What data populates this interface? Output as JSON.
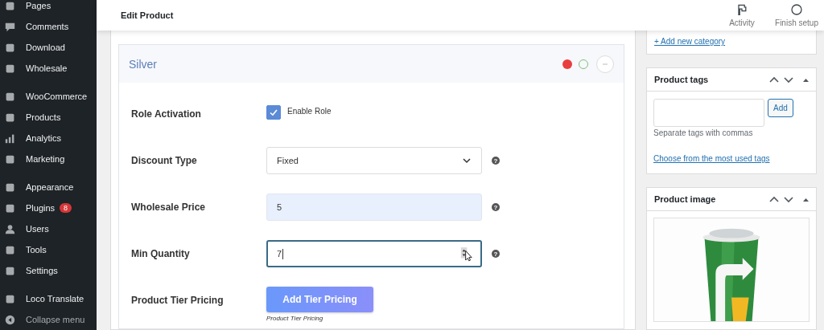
{
  "sidebar": {
    "groups": [
      [
        {
          "label": "Pages"
        },
        {
          "label": "Comments"
        },
        {
          "label": "Download"
        },
        {
          "label": "Wholesale"
        }
      ],
      [
        {
          "label": "WooCommerce"
        },
        {
          "label": "Products"
        },
        {
          "label": "Analytics"
        },
        {
          "label": "Marketing"
        }
      ],
      [
        {
          "label": "Appearance"
        },
        {
          "label": "Plugins",
          "badge": "8"
        },
        {
          "label": "Users"
        },
        {
          "label": "Tools"
        },
        {
          "label": "Settings"
        }
      ],
      [
        {
          "label": "Loco Translate"
        },
        {
          "label": "Collapse menu",
          "kind": "collapse"
        }
      ]
    ]
  },
  "header": {
    "title": "Edit Product",
    "actions": [
      {
        "label": "Activity"
      },
      {
        "label": "Finish setup"
      }
    ]
  },
  "role_box": {
    "title": "Silver",
    "rows": [
      {
        "kind": "checkbox",
        "label": "Role Activation",
        "option": "Enable Role",
        "checked": true
      },
      {
        "kind": "select",
        "label": "Discount Type",
        "value": "Fixed",
        "help": "?"
      },
      {
        "kind": "input",
        "label": "Wholesale Price",
        "value": "5",
        "focused": false,
        "help": "?"
      },
      {
        "kind": "number",
        "label": "Min Quantity",
        "value": "7",
        "focused": true,
        "help": "?"
      },
      {
        "kind": "button",
        "label": "Product Tier Pricing",
        "button": "Add Tier Pricing",
        "note": "Product Tier Pricing"
      }
    ]
  },
  "categories": {
    "link": "+ Add new category"
  },
  "product_tags": {
    "title": "Product tags",
    "button": "Add",
    "hint": "Separate tags with commas",
    "link": "Choose from the most used tags"
  },
  "product_image": {
    "title": "Product image"
  }
}
